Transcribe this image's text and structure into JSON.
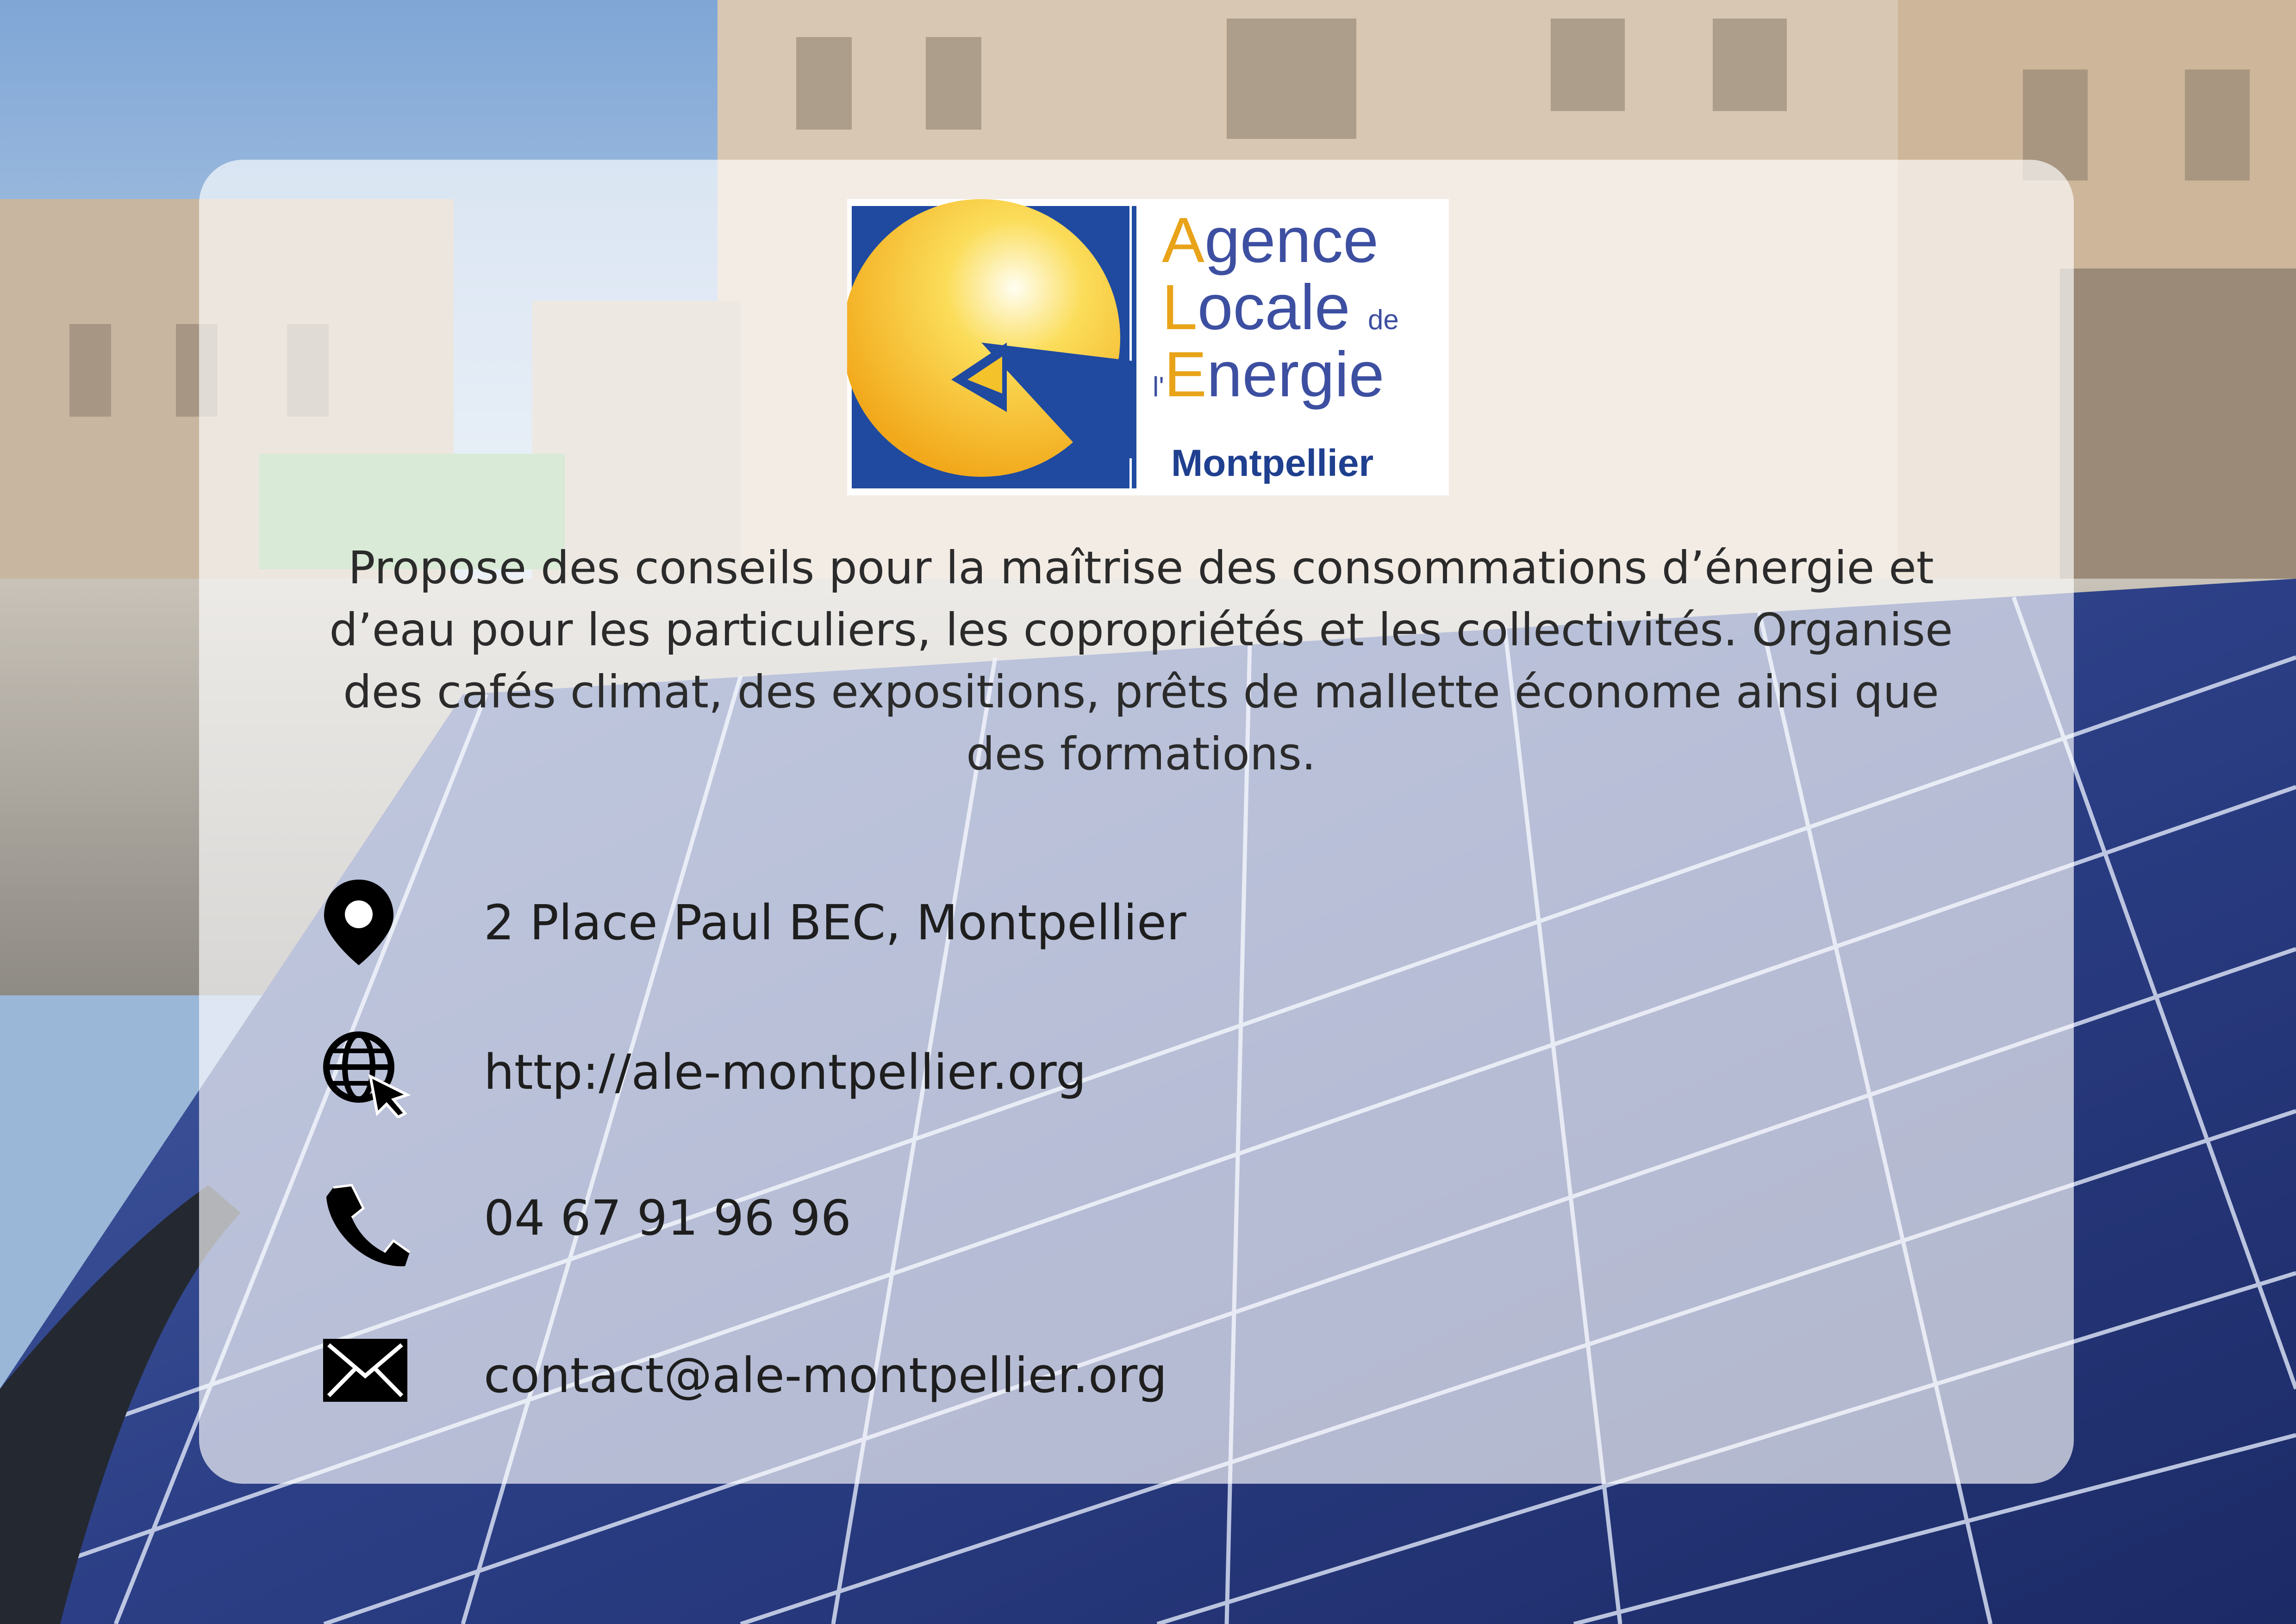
{
  "logo": {
    "line1_cap": "A",
    "line1_rest": "gence",
    "line2_cap": "L",
    "line2_rest": "ocale",
    "line2_suffix": "de",
    "line3_prefix": "l'",
    "line3_cap": "E",
    "line3_rest": "nergie",
    "line4": "Montpellier"
  },
  "description": "Propose des conseils pour la maîtrise des consommations d’énergie et d’eau pour les particuliers, les copropriétés et les collectivités. Organise des cafés climat, des expositions, prêts de mallette économe ainsi que des formations.",
  "contacts": {
    "address": "2 Place Paul BEC, Montpellier",
    "website": "http://ale-montpellier.org",
    "phone": "04 67 91 96 96",
    "email": "contact@ale-montpellier.org"
  },
  "icons": {
    "address": "map-pin-icon",
    "website": "globe-cursor-icon",
    "phone": "phone-icon",
    "email": "envelope-icon"
  },
  "colors": {
    "logo_blue": "#1f3f8f",
    "logo_yellow": "#f2b816",
    "logo_orange": "#e8a318"
  }
}
